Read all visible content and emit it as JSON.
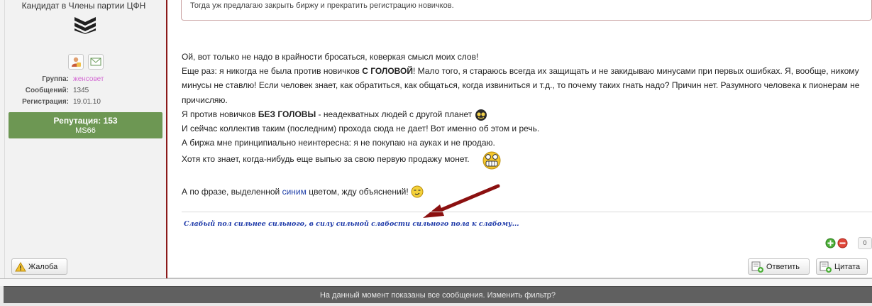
{
  "author": {
    "rank": "Кандидат в Члены партии ЦФН",
    "icons": [
      "profile-icon",
      "message-icon"
    ],
    "stats": [
      {
        "label": "Группа:",
        "value": "женсовет"
      },
      {
        "label": "Сообщений:",
        "value": "1345"
      },
      {
        "label": "Регистрация:",
        "value": "19.01.10"
      }
    ],
    "reputation_label": "Репутация: 153",
    "reputation_sub": "MS66",
    "complaint_button": "Жалоба"
  },
  "quote": {
    "text": "Тогда уж предлагаю закрыть биржу и прекратить регистрацию новичков."
  },
  "post": {
    "line1": "Ой, вот только не надо в крайности бросаться, коверкая смысл моих слов!",
    "line2a": "Еще раз: я никогда не была против новичков ",
    "line2b": "С ГОЛОВОЙ",
    "line2c": "! Мало того, я стараюсь всегда их защищать и не закидываю минусами при первых ошибках. Я, вообще, никому минусы не ставлю! Если человек знает, как обратиться, как общаться, когда извиниться и т.д., то почему таких гнать надо? Причин нет. Разумного человека к пионерам не причисляю.",
    "line3a": "Я против новичков ",
    "line3b": "БЕЗ ГОЛОВЫ",
    "line3c": " - неадекватных людей с другой планет",
    "line4": "И сейчас коллектив таким (последним) прохода сюда не дает! Вот именно об этом и речь.",
    "line5": "А биржа мне принципиально неинтересна: я не покупаю на ауках и не продаю.",
    "line6": "Хотя кто знает, когда-нибудь еще выпью за свою первую продажу монет.",
    "line7a": "А по фразе, выделенной ",
    "line7b": "синим",
    "line7c": " цветом, жду объяснений!"
  },
  "signature": "Слабый пол сильнее сильного, в силу сильной слабости сильного пола к слабому...",
  "vote": {
    "count": "0"
  },
  "actions": {
    "reply": "Ответить",
    "quote": "Цитата"
  },
  "footer": {
    "text": "На данный момент показаны все сообщения. ",
    "link": "Изменить фильтр?"
  },
  "colors": {
    "reputation": "#6d9753",
    "sidebar_border": "#8b1a1a",
    "signature": "#1c38a8",
    "arrow": "#8b1010"
  }
}
